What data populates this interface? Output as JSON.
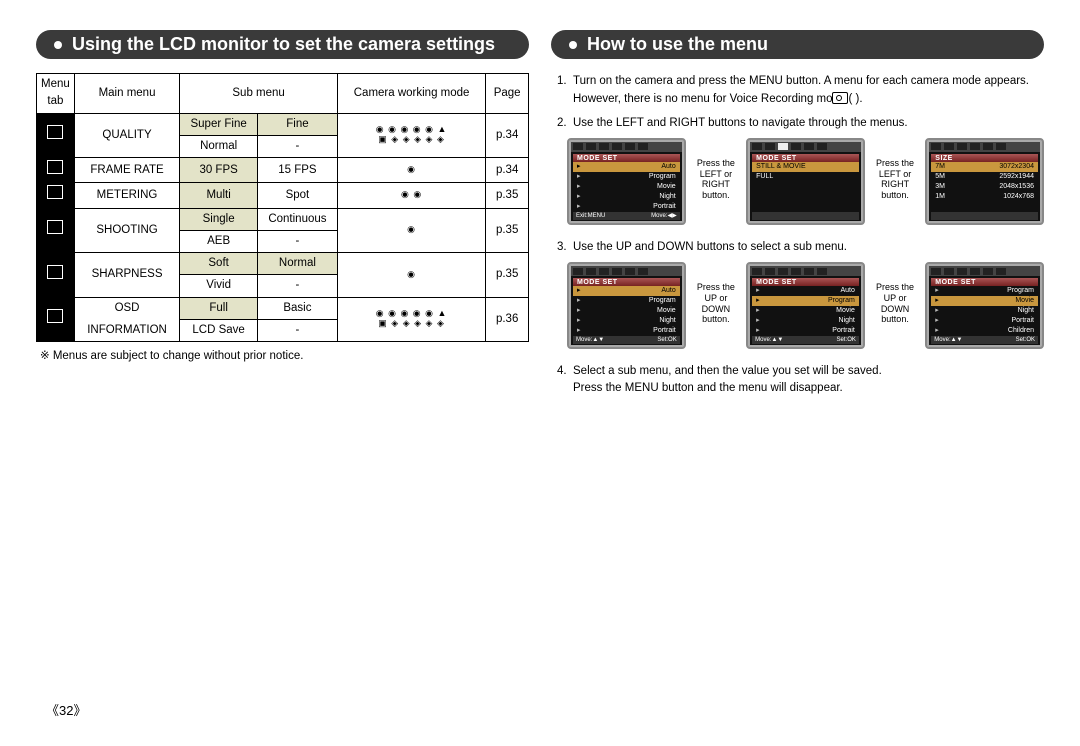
{
  "page_number": "《32》",
  "left": {
    "title": "Using the LCD monitor to set the camera settings",
    "headers": [
      "Menu tab",
      "Main menu",
      "Sub menu",
      "Camera working mode",
      "Page"
    ],
    "rows": [
      {
        "main": "QUALITY",
        "sub1": "Super Fine",
        "sub1_sel": true,
        "sub2": "Fine",
        "sub2_sel": true,
        "sub3": "Normal",
        "sub4": "-",
        "page": "p.34"
      },
      {
        "main": "FRAME RATE",
        "sub1": "30 FPS",
        "sub1_sel": true,
        "sub2": "15 FPS",
        "page": "p.34"
      },
      {
        "main": "METERING",
        "sub1": "Multi",
        "sub1_sel": true,
        "sub2": "Spot",
        "page": "p.35"
      },
      {
        "main": "SHOOTING",
        "sub1": "Single",
        "sub1_sel": true,
        "sub2": "Continuous",
        "sub3": "AEB",
        "sub4": "-",
        "page": "p.35"
      },
      {
        "main": "SHARPNESS",
        "sub1": "Soft",
        "sub1_sel": true,
        "sub2": "Normal",
        "sub2_sel": true,
        "sub3": "Vivid",
        "sub4": "-",
        "page": "p.35"
      },
      {
        "main": "OSD INFORMATION",
        "main1": "OSD",
        "main2": "INFORMATION",
        "sub1": "Full",
        "sub1_sel": true,
        "sub2": "Basic",
        "sub3": "LCD Save",
        "sub4": "-",
        "page": "p.36"
      }
    ],
    "note": "※ Menus are subject to change without prior notice."
  },
  "right": {
    "title": "How to use the menu",
    "step1": "Turn on the camera and press the MENU button. A menu for each camera mode appears. However, there is no menu for Voice Recording mode (        ).",
    "step2": "Use the LEFT and RIGHT buttons to navigate through the menus.",
    "step3": "Use the UP and DOWN buttons to select a sub menu.",
    "step4a": "Select a sub menu, and then the value you set will be saved.",
    "step4b": "Press the MENU button and the menu will disappear.",
    "caption_lr": "Press the LEFT or RIGHT button.",
    "caption_ud": "Press the UP or DOWN button.",
    "lcd_modeset": {
      "header": "MODE SET",
      "items": [
        [
          "",
          "Auto"
        ],
        [
          "",
          "Program"
        ],
        [
          "",
          "Movie"
        ],
        [
          "",
          "Night"
        ],
        [
          "",
          "Portrait"
        ]
      ],
      "footer": [
        "Exit:MENU",
        "Move:◀▶"
      ]
    },
    "lcd_stillmovie": {
      "header": "MODE SET",
      "items": [
        [
          "STILL & MOVIE",
          ""
        ],
        [
          "FULL",
          ""
        ]
      ]
    },
    "lcd_size": {
      "header": "SIZE",
      "items": [
        [
          "7M",
          "3072x2304"
        ],
        [
          "5M",
          "2592x1944"
        ],
        [
          "3M",
          "2048x1536"
        ],
        [
          "1M",
          "1024x768"
        ]
      ]
    },
    "lcd_modeset2_footer": [
      "Move:▲▼",
      "Set:OK"
    ],
    "lcd_children": {
      "header": "MODE SET",
      "items": [
        [
          "",
          "Program"
        ],
        [
          "",
          "Movie"
        ],
        [
          "",
          "Night"
        ],
        [
          "",
          "Portrait"
        ],
        [
          "",
          "Children"
        ]
      ]
    }
  }
}
